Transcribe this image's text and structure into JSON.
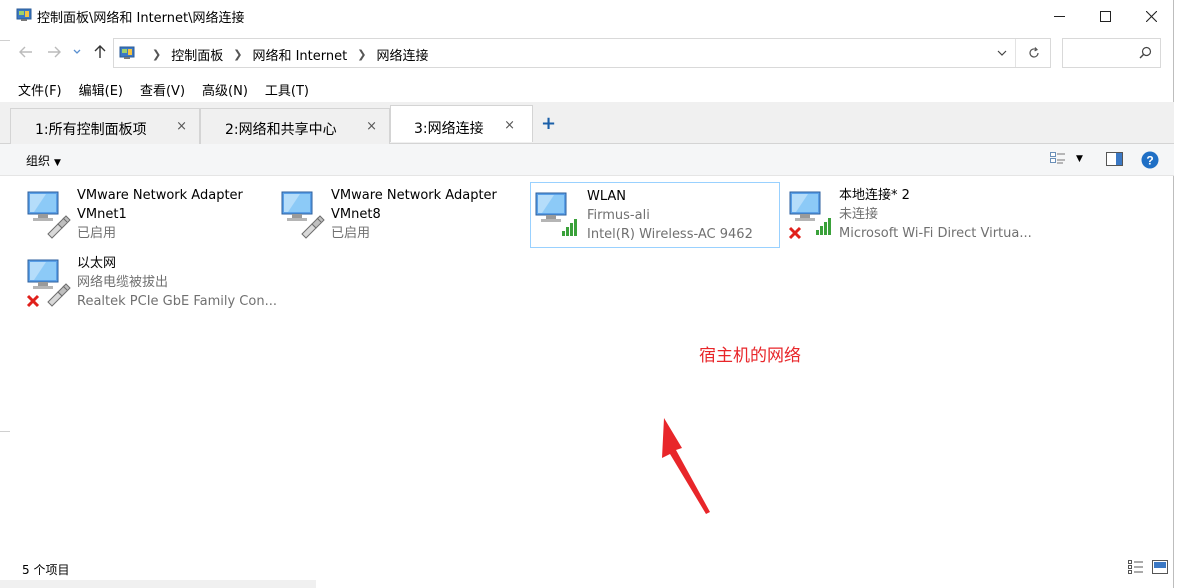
{
  "window": {
    "title": "控制面板\\网络和 Internet\\网络连接",
    "minimize_label": "—",
    "maximize_label": "☐",
    "close_label": "✕"
  },
  "address": {
    "crumbs": [
      "控制面板",
      "网络和 Internet",
      "网络连接"
    ],
    "search_placeholder": ""
  },
  "menu": [
    {
      "label": "文件(F)"
    },
    {
      "label": "编辑(E)"
    },
    {
      "label": "查看(V)"
    },
    {
      "label": "高级(N)"
    },
    {
      "label": "工具(T)"
    }
  ],
  "tabs": [
    {
      "label": "1:所有控制面板项",
      "close": "×"
    },
    {
      "label": "2:网络和共享中心",
      "close": "×"
    },
    {
      "label": "3:网络连接",
      "close": "×"
    }
  ],
  "tab_add": "+",
  "toolbar": {
    "organize": "组织",
    "organize_caret": "▼"
  },
  "connections": [
    {
      "name": "VMware Network Adapter",
      "line1": "VMnet1",
      "line2": "已启用",
      "status": "enabled",
      "type": "wired"
    },
    {
      "name": "VMware Network Adapter",
      "line1": "VMnet8",
      "line2": "已启用",
      "status": "enabled",
      "type": "wired"
    },
    {
      "name": "WLAN",
      "line1": "Firmus-ali",
      "line2": "Intel(R) Wireless-AC 9462",
      "status": "connected",
      "type": "wireless",
      "selected": true
    },
    {
      "name": "本地连接* 2",
      "line1": "未连接",
      "line2": "Microsoft Wi-Fi Direct Virtua...",
      "status": "disconnected",
      "type": "wireless"
    },
    {
      "name": "以太网",
      "line1": "网络电缆被拔出",
      "line2": "Realtek PCIe GbE Family Con...",
      "status": "disconnected",
      "type": "wired"
    }
  ],
  "annotation": {
    "text": "宿主机的网络",
    "color": "#e8262a"
  },
  "status": {
    "count": "5 个项目"
  },
  "colors": {
    "accent": "#1a5fa8",
    "selection_border": "#99d1ff",
    "signal_green": "#3aa13a",
    "error_red": "#e0201b"
  }
}
